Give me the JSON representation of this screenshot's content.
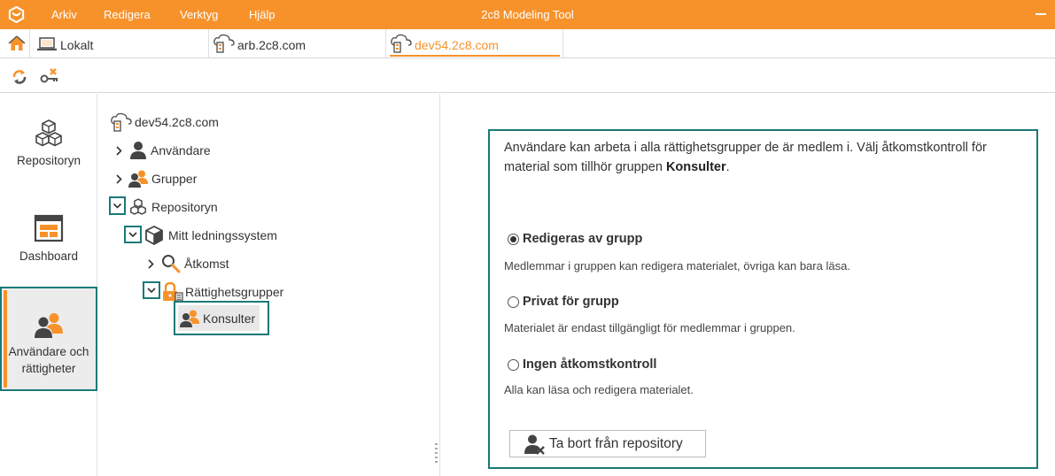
{
  "app": {
    "title": "2c8 Modeling Tool",
    "menu": [
      "Arkiv",
      "Redigera",
      "Verktyg",
      "Hjälp"
    ],
    "accent_color": "#f7922b",
    "highlight_color": "#1a7a78"
  },
  "tabs": [
    {
      "label": "Lokalt",
      "icon": "laptop-icon",
      "active": false
    },
    {
      "label": "arb.2c8.com",
      "icon": "cloud-server-icon",
      "active": false
    },
    {
      "label": "dev54.2c8.com",
      "icon": "cloud-server-icon",
      "active": true
    }
  ],
  "toolbar": {
    "icons": [
      "sync-icon",
      "disconnect-key-icon"
    ]
  },
  "leftnav": [
    {
      "label": "Repositoryn",
      "icon": "cubes-icon"
    },
    {
      "label": "Dashboard",
      "icon": "dashboard-icon"
    },
    {
      "label": "Användare och rättigheter",
      "icon": "users-icon",
      "active": true
    }
  ],
  "tree": {
    "root": "dev54.2c8.com",
    "nodes": [
      {
        "label": "Användare",
        "icon": "user-icon"
      },
      {
        "label": "Grupper",
        "icon": "group-icon"
      },
      {
        "label": "Repositoryn",
        "icon": "cubes-icon"
      },
      {
        "label": "Mitt ledningssystem",
        "icon": "cube-icon"
      },
      {
        "label": "Åtkomst",
        "icon": "search-icon"
      },
      {
        "label": "Rättighetsgrupper",
        "icon": "lock-group-icon"
      },
      {
        "label": "Konsulter",
        "icon": "group-icon"
      }
    ]
  },
  "details": {
    "description_pre": "Användare kan arbeta i alla rättighetsgrupper de är medlem i. Välj åtkomstkontroll för material som tillhör gruppen ",
    "group_name": "Konsulter",
    "description_post": ".",
    "options": [
      {
        "label": "Redigeras av grupp",
        "desc": "Medlemmar i gruppen kan redigera materialet, övriga kan bara läsa.",
        "selected": true
      },
      {
        "label": "Privat för grupp",
        "desc": "Materialet är endast tillgängligt för medlemmar i gruppen.",
        "selected": false
      },
      {
        "label": "Ingen åtkomstkontroll",
        "desc": "Alla kan läsa och redigera materialet.",
        "selected": false
      }
    ],
    "remove_button": "Ta bort från repository"
  }
}
